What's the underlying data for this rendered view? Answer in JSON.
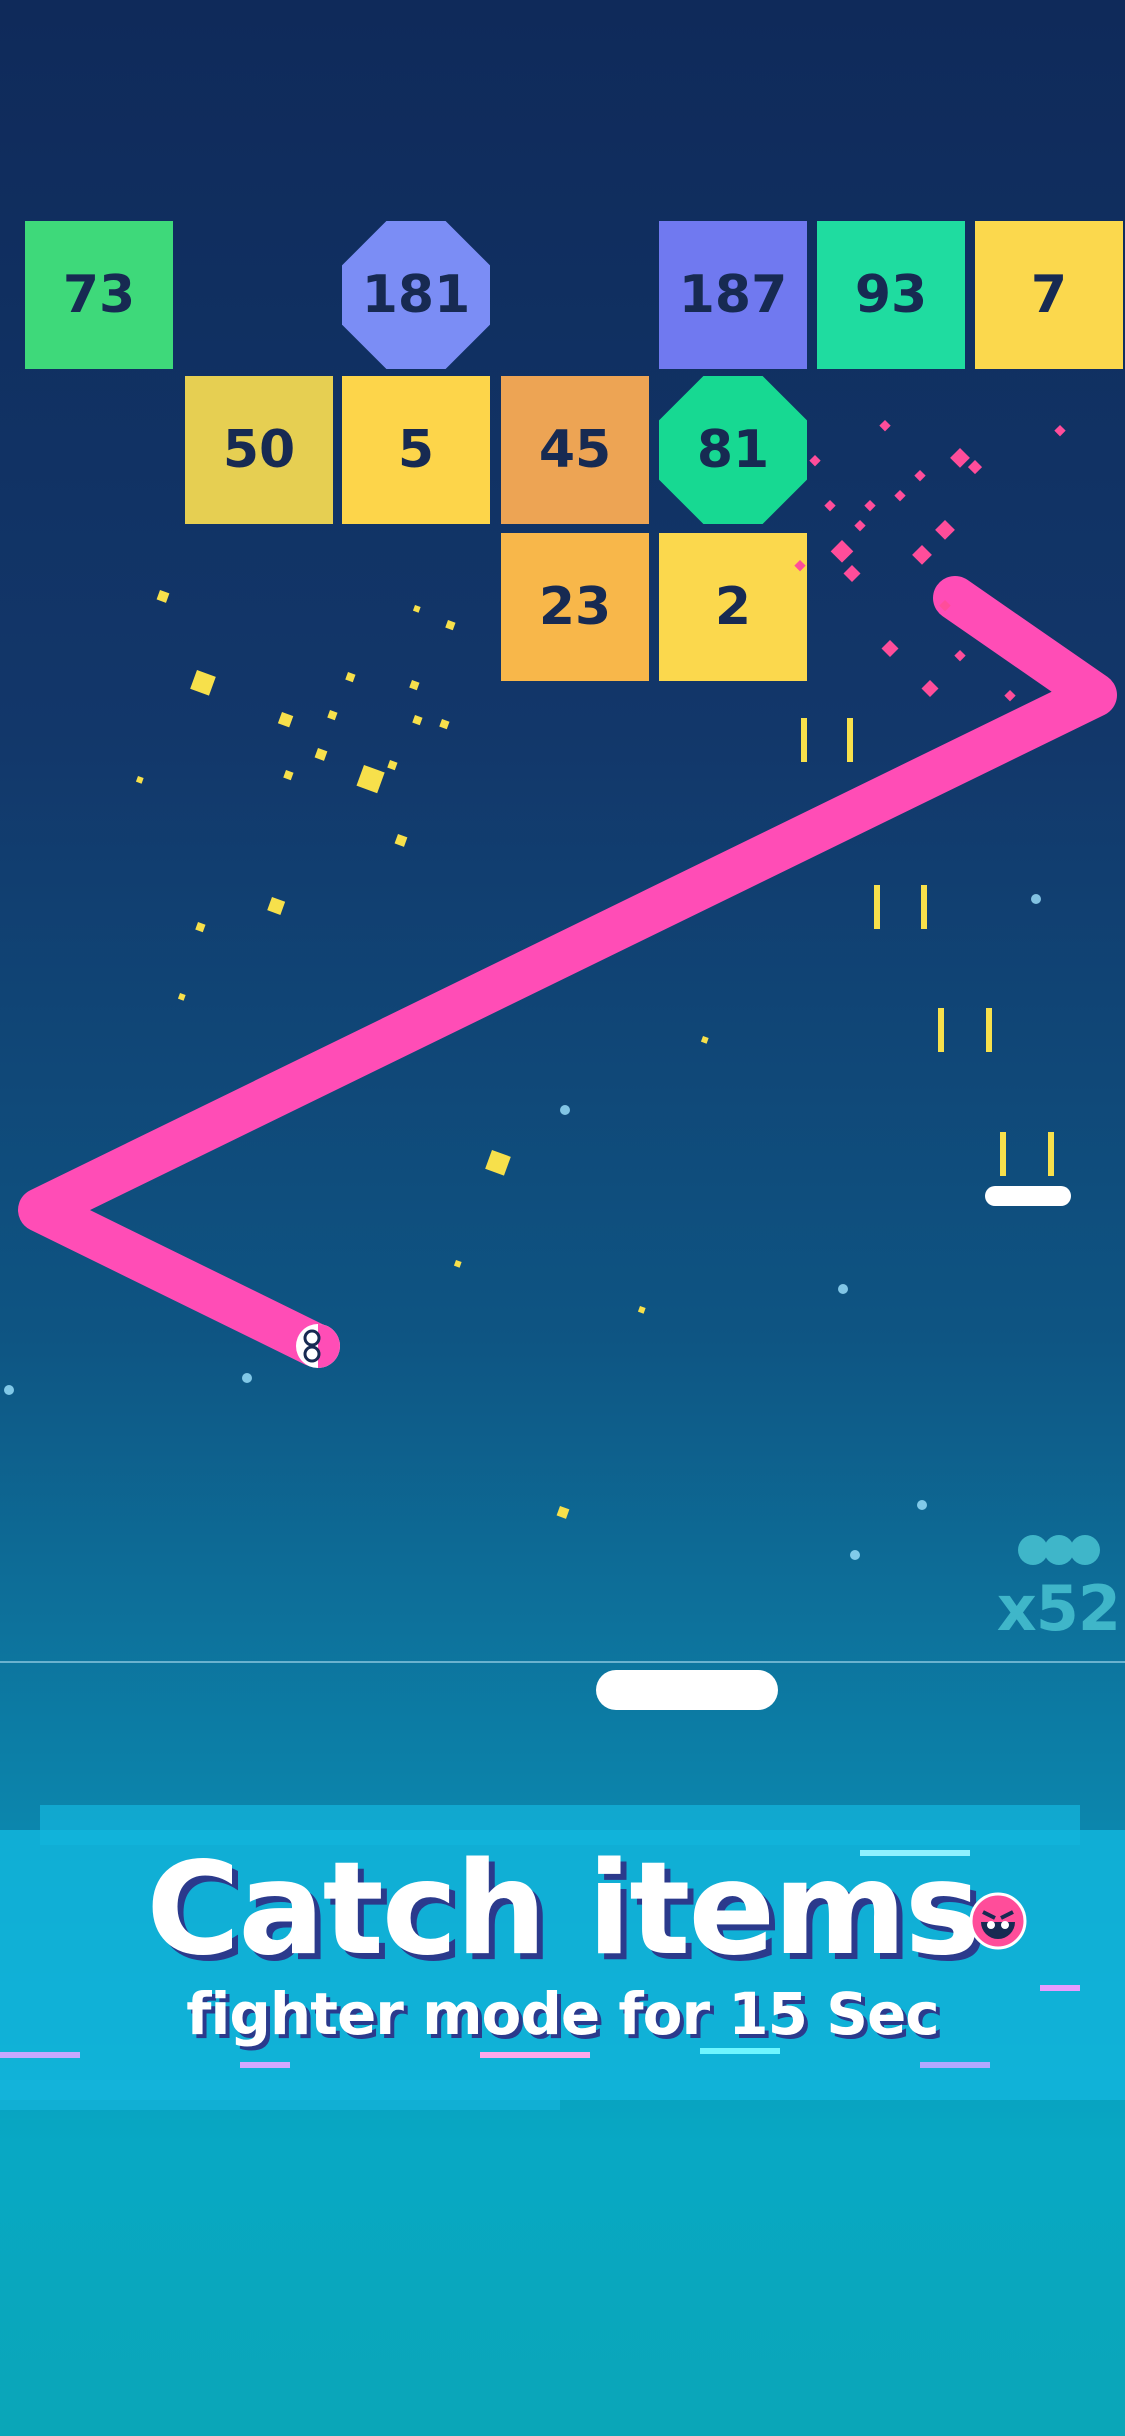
{
  "bricks": [
    {
      "value": "73",
      "color": "#3ed97a",
      "shape": "square",
      "row": 0,
      "col": 0
    },
    {
      "value": "181",
      "color": "#7b8df5",
      "shape": "octagon",
      "row": 0,
      "col": 2
    },
    {
      "value": "187",
      "color": "#7079f0",
      "shape": "square",
      "row": 0,
      "col": 4
    },
    {
      "value": "93",
      "color": "#1fdca0",
      "shape": "square",
      "row": 0,
      "col": 5
    },
    {
      "value": "7",
      "color": "#fbd84d",
      "shape": "square",
      "row": 0,
      "col": 6
    },
    {
      "value": "50",
      "color": "#e6cf52",
      "shape": "square",
      "row": 1,
      "col": 1
    },
    {
      "value": "5",
      "color": "#fdd54a",
      "shape": "square",
      "row": 1,
      "col": 2
    },
    {
      "value": "45",
      "color": "#eda454",
      "shape": "square",
      "row": 1,
      "col": 3
    },
    {
      "value": "81",
      "color": "#17d992",
      "shape": "octagon",
      "row": 1,
      "col": 4
    },
    {
      "value": "23",
      "color": "#f8b74a",
      "shape": "square",
      "row": 2,
      "col": 3
    },
    {
      "value": "2",
      "color": "#fbd84d",
      "shape": "square",
      "row": 2,
      "col": 4
    }
  ],
  "snake": {
    "color": "#ff4db6",
    "face_icon": "snake-head-face-icon"
  },
  "hud": {
    "ball_count": "x52",
    "ball_color": "#3fb6c9"
  },
  "banner": {
    "title": "Catch items",
    "subtitle": "fighter mode for 15 Sec",
    "icon": "angry-face-icon"
  },
  "colors": {
    "background_top": "#0f2a5a",
    "background_bottom": "#0aa6b8",
    "particle_yellow": "#f7e04b",
    "particle_pink": "#ff4d9a",
    "paddle": "#ffffff"
  }
}
